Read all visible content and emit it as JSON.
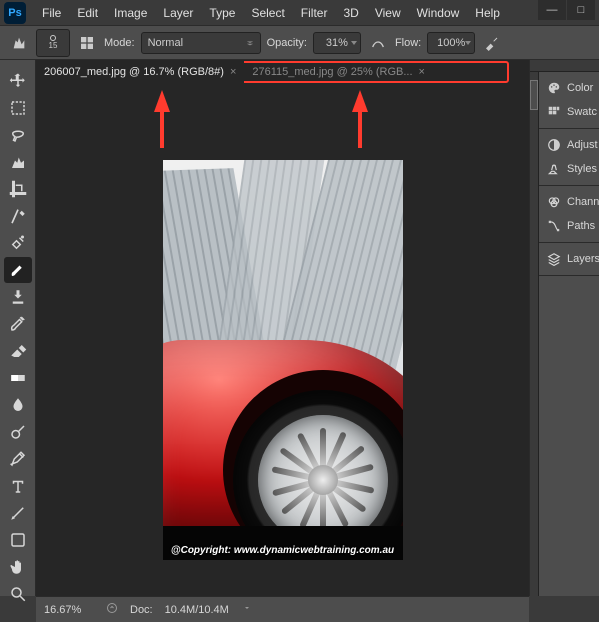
{
  "app": {
    "logo_text": "Ps"
  },
  "menu": [
    "File",
    "Edit",
    "Image",
    "Layer",
    "Type",
    "Select",
    "Filter",
    "3D",
    "View",
    "Window",
    "Help"
  ],
  "window_buttons": {
    "minimize": "—",
    "maximize": "□",
    "close": ""
  },
  "options": {
    "brush_size": "15",
    "mode_label": "Mode:",
    "mode_value": "Normal",
    "opacity_label": "Opacity:",
    "opacity_value": "31%",
    "flow_label": "Flow:",
    "flow_value": "100%"
  },
  "tools": [
    {
      "name": "move-tool"
    },
    {
      "name": "marquee-tool"
    },
    {
      "name": "lasso-tool"
    },
    {
      "name": "quick-select-tool"
    },
    {
      "name": "crop-tool"
    },
    {
      "name": "eyedropper-tool"
    },
    {
      "name": "healing-brush-tool"
    },
    {
      "name": "brush-tool",
      "selected": true
    },
    {
      "name": "clone-stamp-tool"
    },
    {
      "name": "history-brush-tool"
    },
    {
      "name": "eraser-tool"
    },
    {
      "name": "gradient-tool"
    },
    {
      "name": "blur-tool"
    },
    {
      "name": "dodge-tool"
    },
    {
      "name": "pen-tool"
    },
    {
      "name": "type-tool"
    },
    {
      "name": "path-select-tool"
    },
    {
      "name": "shape-tool"
    },
    {
      "name": "hand-tool"
    },
    {
      "name": "zoom-tool"
    }
  ],
  "documents": {
    "tabs": [
      {
        "label": "206007_med.jpg @ 16.7% (RGB/8#)",
        "active": true
      },
      {
        "label": "276115_med.jpg @ 25% (RGB...",
        "active": false
      }
    ]
  },
  "panels": [
    {
      "group": [
        {
          "name": "color-panel",
          "label": "Color",
          "icon": "palette"
        },
        {
          "name": "swatches-panel",
          "label": "Swatc",
          "icon": "swatches"
        }
      ]
    },
    {
      "group": [
        {
          "name": "adjustments-panel",
          "label": "Adjust",
          "icon": "adjust"
        },
        {
          "name": "styles-panel",
          "label": "Styles",
          "icon": "styles"
        }
      ]
    },
    {
      "group": [
        {
          "name": "channels-panel",
          "label": "Chann",
          "icon": "channels"
        },
        {
          "name": "paths-panel",
          "label": "Paths",
          "icon": "paths"
        }
      ]
    },
    {
      "group": [
        {
          "name": "layers-panel",
          "label": "Layers",
          "icon": "layers"
        }
      ]
    }
  ],
  "status": {
    "zoom": "16.67%",
    "doc_label": "Doc:",
    "doc_value": "10.4M/10.4M"
  },
  "canvas": {
    "copyright": "@Copyright: www.dynamicwebtraining.com.au"
  }
}
